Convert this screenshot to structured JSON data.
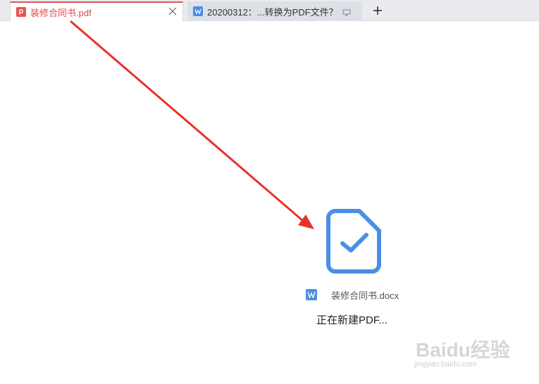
{
  "tabs": [
    {
      "label": "装修合同书.pdf",
      "icon": "pdf-icon",
      "active": true
    },
    {
      "label": "20200312：...转换为PDF文件？",
      "icon": "word-icon",
      "active": false
    }
  ],
  "new_tab_label": "+",
  "main": {
    "file_name": "装修合同书.docx",
    "status": "正在新建PDF..."
  },
  "watermark": {
    "main": "Baidu经验",
    "sub": "jingyan.baidu.com"
  },
  "colors": {
    "accent_red": "#e85450",
    "doc_blue": "#4a8ee6",
    "arrow_red": "#e8332a"
  }
}
